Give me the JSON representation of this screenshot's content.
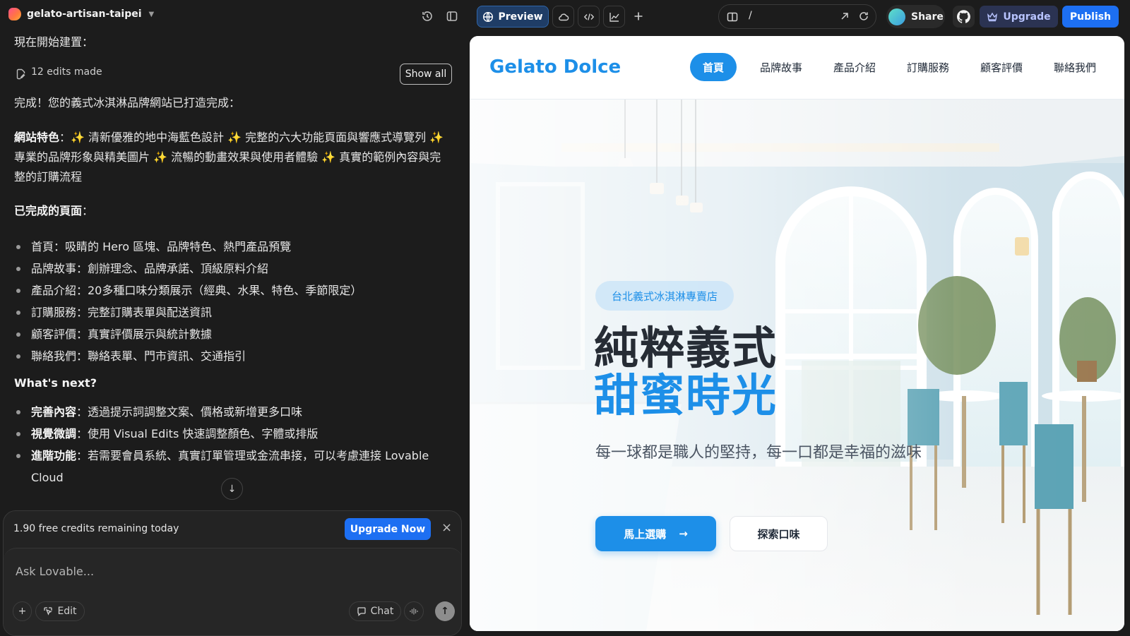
{
  "topbar": {
    "project_name": "gelato-artisan-taipei",
    "preview_label": "Preview",
    "url_path": "/",
    "share_label": "Share",
    "upgrade_label": "Upgrade",
    "publish_label": "Publish"
  },
  "chat": {
    "intro": "現在開始建置：",
    "edits_count": "12 edits made",
    "show_all": "Show all",
    "done": "完成！您的義式冰淇淋品牌網站已打造完成：",
    "features_title": "網站特色",
    "features_text": "：✨ 清新優雅的地中海藍色設計 ✨ 完整的六大功能頁面與響應式導覽列 ✨ 專業的品牌形象與精美圖片 ✨ 流暢的動畫效果與使用者體驗 ✨ 真實的範例內容與完整的訂購流程",
    "pages_title": "已完成的頁面",
    "pages_colon": "：",
    "pages": [
      "首頁：吸睛的 Hero 區塊、品牌特色、熱門產品預覽",
      "品牌故事：創辦理念、品牌承諾、頂級原料介紹",
      "產品介紹：20多種口味分類展示（經典、水果、特色、季節限定）",
      "訂購服務：完整訂購表單與配送資訊",
      "顧客評價：真實評價展示與統計數據",
      "聯絡我們：聯絡表單、門市資訊、交通指引"
    ],
    "next_title": "What's next?",
    "next_items": [
      {
        "label": "完善內容",
        "text": "：透過提示詞調整文案、價格或新增更多口味"
      },
      {
        "label": "視覺微調",
        "text": "：使用 Visual Edits 快速調整顏色、字體或排版"
      },
      {
        "label": "進階功能",
        "text": "：若需要會員系統、真實訂單管理或金流串接，可以考慮連接 Lovable Cloud"
      }
    ]
  },
  "composer": {
    "credits": "1.90 free credits remaining today",
    "upgrade_now": "Upgrade Now",
    "placeholder": "Ask Lovable...",
    "edit_label": "Edit",
    "chat_label": "Chat"
  },
  "site": {
    "brand": "Gelato Dolce",
    "nav": [
      "首頁",
      "品牌故事",
      "產品介紹",
      "訂購服務",
      "顧客評價",
      "聯絡我們"
    ],
    "badge": "台北義式冰淇淋專賣店",
    "headline_1": "純粹義式",
    "headline_2": "甜蜜時光",
    "subtitle": "每一球都是職人的堅持，每一口都是幸福的滋味",
    "cta_primary": "馬上選購",
    "cta_secondary": "探索口味",
    "colors": {
      "brand_blue": "#1d8fe8",
      "publish_blue": "#1d6ff2"
    }
  }
}
